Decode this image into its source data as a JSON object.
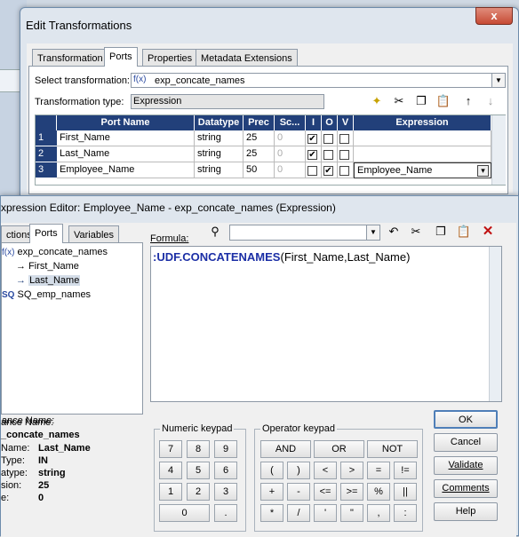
{
  "transformations_dialog": {
    "title": "Edit Transformations",
    "close_label": "x",
    "tabs": [
      "Transformation",
      "Ports",
      "Properties",
      "Metadata Extensions"
    ],
    "select_transformation_label": "Select transformation:",
    "select_transformation_value": "exp_concate_names",
    "transformation_type_label": "Transformation type:",
    "transformation_type_value": "Expression",
    "grid_headers": [
      "Port Name",
      "Datatype",
      "Prec",
      "Sc...",
      "I",
      "O",
      "V",
      "Expression"
    ],
    "rows": [
      {
        "num": "1",
        "port": "First_Name",
        "datatype": "string",
        "prec": "25",
        "scale": "0",
        "i": true,
        "o": false,
        "v": false,
        "expr": ""
      },
      {
        "num": "2",
        "port": "Last_Name",
        "datatype": "string",
        "prec": "25",
        "scale": "0",
        "i": true,
        "o": false,
        "v": false,
        "expr": ""
      },
      {
        "num": "3",
        "port": "Employee_Name",
        "datatype": "string",
        "prec": "50",
        "scale": "0",
        "i": false,
        "o": true,
        "v": false,
        "expr": "Employee_Name"
      }
    ],
    "toolbar_icons": [
      "new-port-icon",
      "cut-icon",
      "copy-icon",
      "paste-icon",
      "move-up-icon",
      "move-down-icon"
    ]
  },
  "expression_editor": {
    "title": "xpression Editor: Employee_Name - exp_concate_names (Expression)",
    "tabs": [
      "ctions",
      "Ports",
      "Variables"
    ],
    "formula_label": "Formula:",
    "formula_prefix": ":UDF.CONCATENAMES",
    "formula_args": "(First_Name,Last_Name)",
    "tree": {
      "root": "exp_concate_names",
      "children": [
        "First_Name",
        "Last_Name"
      ],
      "source_badge": "SQ",
      "source": "SQ_emp_names"
    },
    "details": {
      "instance_label": "ance Name:",
      "instance_value": "_concate_names",
      "name_label": "Name:",
      "name_value": "Last_Name",
      "type_label": "Type:",
      "type_value": "IN",
      "datatype_label": "atype:",
      "datatype_value": "string",
      "precision_label": "sion:",
      "precision_value": "25",
      "scale_label": "e:",
      "scale_value": "0"
    },
    "numeric_keypad_label": "Numeric keypad",
    "numeric_keys": [
      "7",
      "8",
      "9",
      "4",
      "5",
      "6",
      "1",
      "2",
      "3",
      "0",
      "."
    ],
    "operator_keypad_label": "Operator keypad",
    "operator_keys_top": [
      "AND",
      "OR",
      "NOT"
    ],
    "operator_keys": [
      "(",
      ")",
      "<",
      ">",
      "=",
      "!=",
      "+",
      "-",
      "<=",
      ">=",
      "%",
      "||",
      "*",
      "/",
      "'",
      "\"",
      ",",
      ":"
    ],
    "buttons": [
      "OK",
      "Cancel",
      "Validate",
      "Comments",
      "Help"
    ]
  },
  "colors": {
    "grid_header": "#22407a",
    "formula_text": "#1c2fa6"
  }
}
